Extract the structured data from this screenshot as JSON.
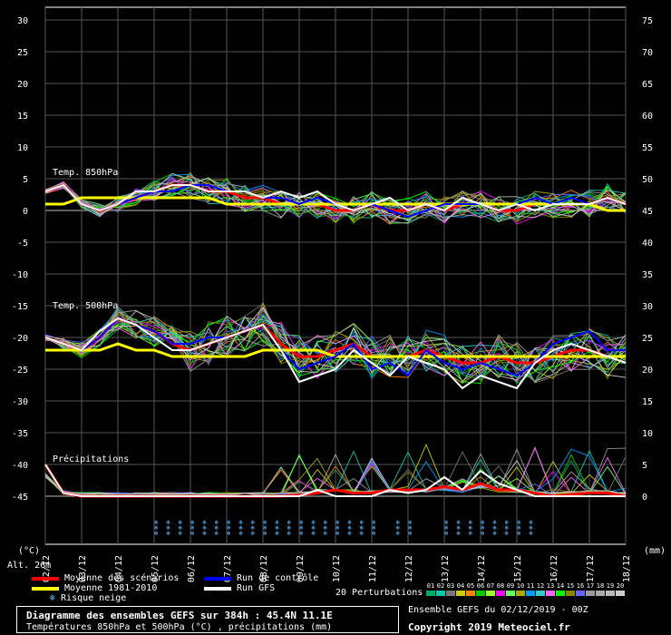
{
  "chart_data": {
    "type": "line",
    "title": "Diagramme des ensembles GEFS sur 384h : 45.4N 11.1E",
    "subtitle": "Températures 850hPa et 500hPa (°C) , précipitations (mm)",
    "run_info": "Ensemble GEFS du 02/12/2019 - 00Z",
    "copyright": "Copyright 2019 Meteociel.fr",
    "left_axis_unit": "(°C)",
    "right_axis_unit": "(mm)",
    "altitude_label": "Alt. 26m",
    "left_ticks": [
      30,
      25,
      20,
      15,
      10,
      5,
      0,
      -5,
      -10,
      -15,
      -20,
      -25,
      -30,
      -35,
      -40,
      -45
    ],
    "right_ticks": [
      75,
      70,
      65,
      60,
      55,
      50,
      45,
      40,
      35,
      30,
      25,
      20,
      15,
      10,
      5,
      0
    ],
    "ylim": [
      -50,
      30
    ],
    "x_ticks": [
      "02/12",
      "03/12",
      "04/12",
      "05/12",
      "06/12",
      "07/12",
      "08/12",
      "09/12",
      "10/12",
      "11/12",
      "12/12",
      "13/12",
      "14/12",
      "15/12",
      "16/12",
      "17/12",
      "18/12"
    ],
    "panel_labels": [
      "Temp. 850hPa",
      "Temp. 500hPa",
      "Précipitations"
    ],
    "series": [
      {
        "name": "Moyenne des scénarios",
        "color": "#ff0000",
        "panel": "t850",
        "values": [
          3,
          4,
          1,
          0,
          1,
          2,
          3,
          4,
          4,
          3,
          3,
          2,
          2,
          1,
          1,
          1,
          0,
          0,
          1,
          0,
          0,
          1,
          0,
          1,
          1,
          0,
          0,
          1,
          1,
          1,
          1,
          2,
          1
        ]
      },
      {
        "name": "Moyenne 1981-2010",
        "color": "#ffff00",
        "panel": "t850",
        "values": [
          1,
          1,
          2,
          2,
          2,
          2,
          2,
          2,
          2,
          2,
          1,
          1,
          1,
          1,
          1,
          1,
          1,
          1,
          1,
          1,
          1,
          1,
          1,
          1,
          1,
          1,
          1,
          1,
          1,
          1,
          1,
          0,
          0
        ]
      },
      {
        "name": "Run de contrôle",
        "color": "#0000ff",
        "panel": "t850",
        "values": [
          3,
          4,
          1,
          0,
          1,
          2,
          3,
          3,
          4,
          4,
          3,
          3,
          2,
          2,
          1,
          2,
          1,
          0,
          1,
          0,
          -1,
          0,
          1,
          1,
          1,
          0,
          1,
          2,
          1,
          2,
          1,
          2,
          1
        ]
      },
      {
        "name": "Run GFS",
        "color": "#ffffff",
        "panel": "t850",
        "values": [
          3,
          4,
          1,
          0,
          1,
          3,
          3,
          4,
          4,
          3,
          3,
          3,
          2,
          3,
          2,
          3,
          1,
          0,
          1,
          2,
          0,
          1,
          0,
          2,
          1,
          0,
          1,
          0,
          1,
          1,
          1,
          2,
          1
        ]
      },
      {
        "name": "Moyenne des scénarios",
        "color": "#ff0000",
        "panel": "t500",
        "values": [
          -20,
          -21,
          -22,
          -20,
          -17,
          -18,
          -19,
          -21,
          -22,
          -21,
          -20,
          -19,
          -18,
          -21,
          -23,
          -23,
          -22,
          -21,
          -23,
          -23,
          -23,
          -22,
          -23,
          -24,
          -24,
          -23,
          -24,
          -24,
          -23,
          -22,
          -22,
          -23,
          -23
        ]
      },
      {
        "name": "Moyenne 1981-2010",
        "color": "#ffff00",
        "panel": "t500",
        "values": [
          -22,
          -22,
          -22,
          -22,
          -21,
          -22,
          -22,
          -23,
          -23,
          -23,
          -23,
          -23,
          -22,
          -22,
          -22,
          -22,
          -23,
          -23,
          -23,
          -23,
          -23,
          -23,
          -23,
          -23,
          -23,
          -23,
          -23,
          -23,
          -23,
          -23,
          -23,
          -23,
          -23
        ]
      },
      {
        "name": "Run de contrôle",
        "color": "#0000ff",
        "panel": "t500",
        "values": [
          -20,
          -21,
          -22,
          -20,
          -17,
          -18,
          -19,
          -21,
          -21,
          -20,
          -20,
          -19,
          -18,
          -22,
          -25,
          -24,
          -23,
          -21,
          -25,
          -24,
          -26,
          -22,
          -24,
          -25,
          -24,
          -25,
          -26,
          -24,
          -21,
          -20,
          -19,
          -22,
          -22
        ]
      },
      {
        "name": "Run GFS",
        "color": "#ffffff",
        "panel": "t500",
        "values": [
          -20,
          -21,
          -22,
          -19,
          -17,
          -18,
          -20,
          -22,
          -22,
          -21,
          -20,
          -19,
          -18,
          -22,
          -27,
          -26,
          -25,
          -22,
          -24,
          -26,
          -23,
          -24,
          -25,
          -28,
          -26,
          -27,
          -28,
          -24,
          -22,
          -21,
          -22,
          -23,
          -24
        ]
      },
      {
        "name": "Moyenne des scénarios",
        "color": "#ff0000",
        "panel": "precip",
        "values": [
          5,
          0.5,
          0,
          0,
          0,
          0,
          0,
          0,
          0,
          0,
          0,
          0,
          0,
          0,
          0.2,
          0.5,
          1,
          0.5,
          0.5,
          1,
          1,
          1,
          1.5,
          1,
          2,
          1,
          1,
          0.5,
          0,
          0.3,
          0.5,
          0.5,
          0
        ]
      },
      {
        "name": "Run GFS",
        "color": "#ffffff",
        "panel": "precip",
        "values": [
          5,
          0.5,
          0,
          0,
          0,
          0,
          0,
          0,
          0,
          0,
          0,
          0,
          0,
          0,
          0,
          1,
          0,
          0,
          0,
          1,
          0.5,
          1,
          3,
          1,
          4,
          2,
          1,
          0,
          0,
          0,
          0,
          0,
          0
        ]
      }
    ],
    "perturbations_label": "20 Perturbations",
    "perturbation_ids": [
      "01",
      "02",
      "03",
      "04",
      "05",
      "06",
      "07",
      "08",
      "09",
      "10",
      "11",
      "12",
      "13",
      "14",
      "15",
      "16",
      "17",
      "18",
      "19",
      "20"
    ],
    "perturbation_colors": [
      "#00aa66",
      "#00ccaa",
      "#777777",
      "#cccc00",
      "#ff8800",
      "#00cc00",
      "#99ff33",
      "#ff00ff",
      "#66ff66",
      "#aaaa00",
      "#0099ff",
      "#33cccc",
      "#ff66ff",
      "#00ff00",
      "#888800",
      "#6666ff",
      "#999999",
      "#aaaaaa",
      "#bbbbbb",
      "#cccccc"
    ],
    "snow_risk_days": [
      9,
      10,
      11,
      12,
      13,
      14,
      15,
      16,
      17,
      18,
      19,
      20,
      21,
      22,
      23,
      24,
      25,
      26,
      27,
      29,
      30,
      33,
      34,
      35,
      36,
      37,
      38,
      39,
      40
    ]
  },
  "legend": {
    "moyenne_scenarios": "Moyenne des scénarios",
    "moyenne_clim": "Moyenne 1981-2010",
    "risque_neige": "Risque neige",
    "run_controle": "Run de contrôle",
    "run_gfs": "Run GFS",
    "colors": {
      "red": "#ff0000",
      "yellow": "#ffff00",
      "blue": "#0000ff",
      "white": "#ffffff",
      "snow": "#66bbff"
    }
  }
}
